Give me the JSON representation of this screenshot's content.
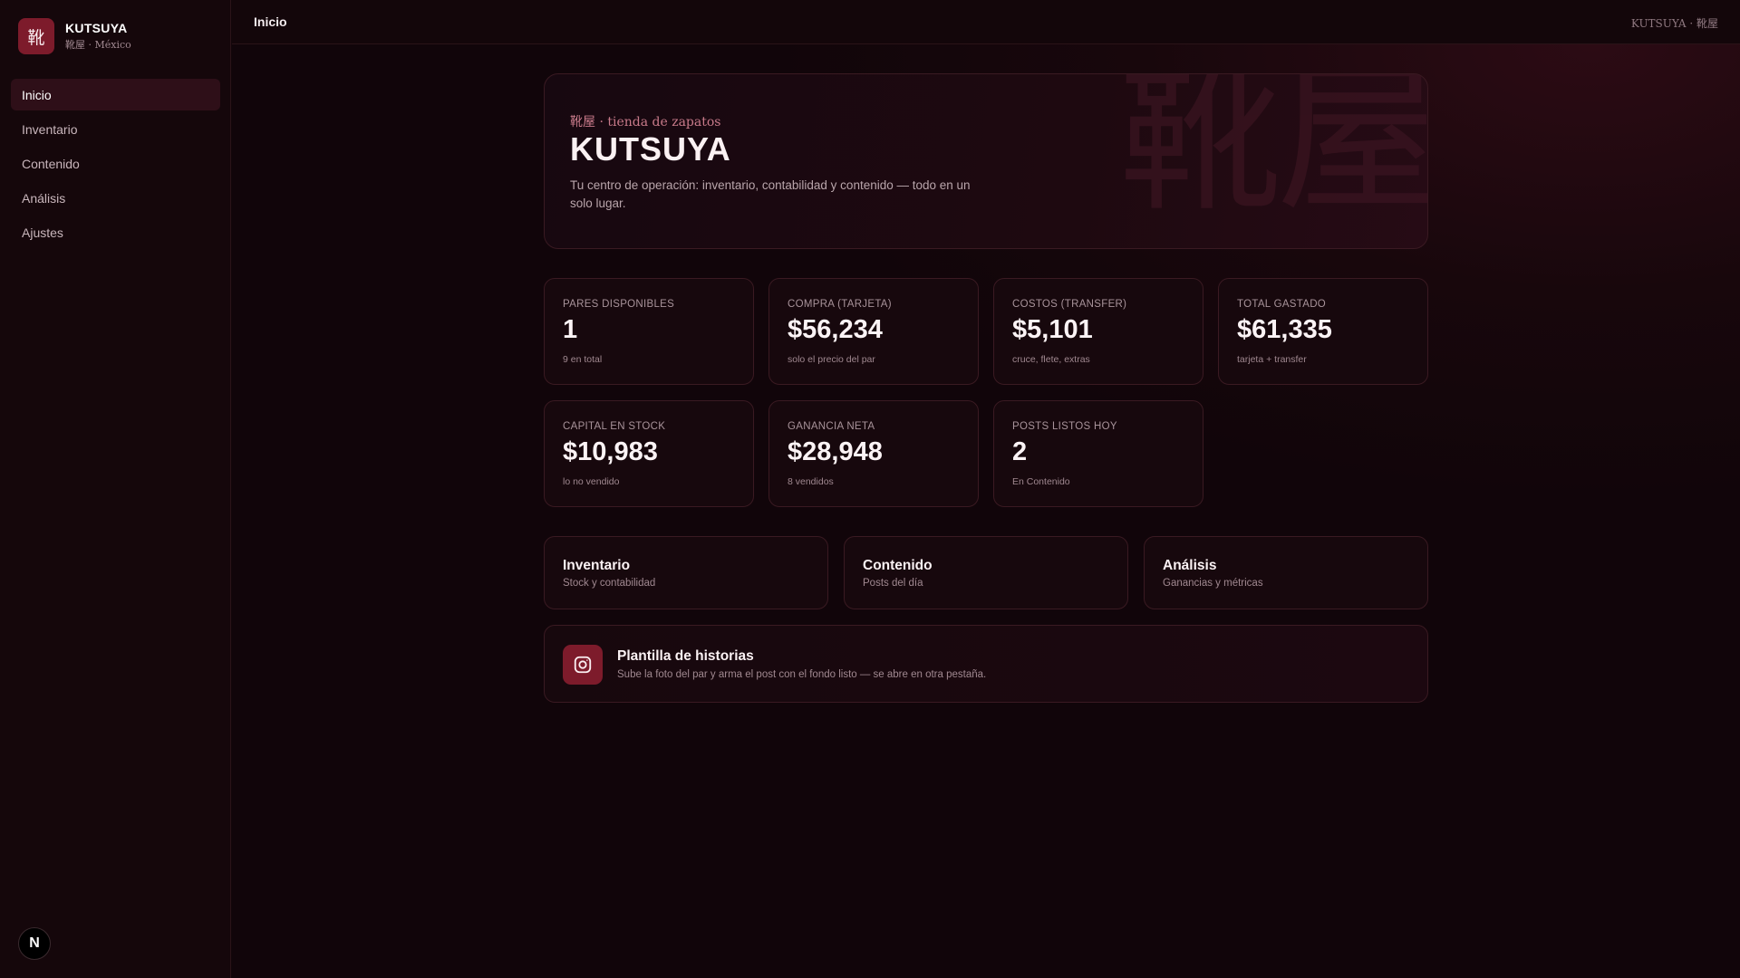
{
  "brand": {
    "logo_glyph": "靴",
    "name": "KUTSUYA",
    "subtitle": "靴屋 · México",
    "accent_color": "#7d1b2b"
  },
  "sidebar": {
    "items": [
      {
        "label": "Inicio",
        "active": true
      },
      {
        "label": "Inventario",
        "active": false
      },
      {
        "label": "Contenido",
        "active": false
      },
      {
        "label": "Análisis",
        "active": false
      },
      {
        "label": "Ajustes",
        "active": false
      }
    ],
    "footer_badge": "N"
  },
  "topbar": {
    "title": "Inicio",
    "right_text": "KUTSUYA · 靴屋"
  },
  "hero": {
    "kanji": "靴屋",
    "subtitle": "靴屋 · tienda de zapatos",
    "title": "KUTSUYA",
    "description": "Tu centro de operación: inventario, contabilidad y contenido — todo en un solo lugar."
  },
  "stats": [
    {
      "label": "PARES DISPONIBLES",
      "value": "1",
      "note": "9 en total"
    },
    {
      "label": "COMPRA (TARJETA)",
      "value": "$56,234",
      "note": "solo el precio del par"
    },
    {
      "label": "COSTOS (TRANSFER)",
      "value": "$5,101",
      "note": "cruce, flete, extras"
    },
    {
      "label": "TOTAL GASTADO",
      "value": "$61,335",
      "note": "tarjeta + transfer"
    },
    {
      "label": "CAPITAL EN STOCK",
      "value": "$10,983",
      "note": "lo no vendido"
    },
    {
      "label": "GANANCIA NETA",
      "value": "$28,948",
      "note": "8 vendidos"
    },
    {
      "label": "POSTS LISTOS HOY",
      "value": "2",
      "note": "En Contenido"
    }
  ],
  "links": [
    {
      "title": "Inventario",
      "subtitle": "Stock y contabilidad"
    },
    {
      "title": "Contenido",
      "subtitle": "Posts del día"
    },
    {
      "title": "Análisis",
      "subtitle": "Ganancias y métricas"
    }
  ],
  "story": {
    "icon": "instagram-icon",
    "title": "Plantilla de historias",
    "subtitle": "Sube la foto del par y arma el post con el fondo listo — se abre en otra pestaña."
  }
}
